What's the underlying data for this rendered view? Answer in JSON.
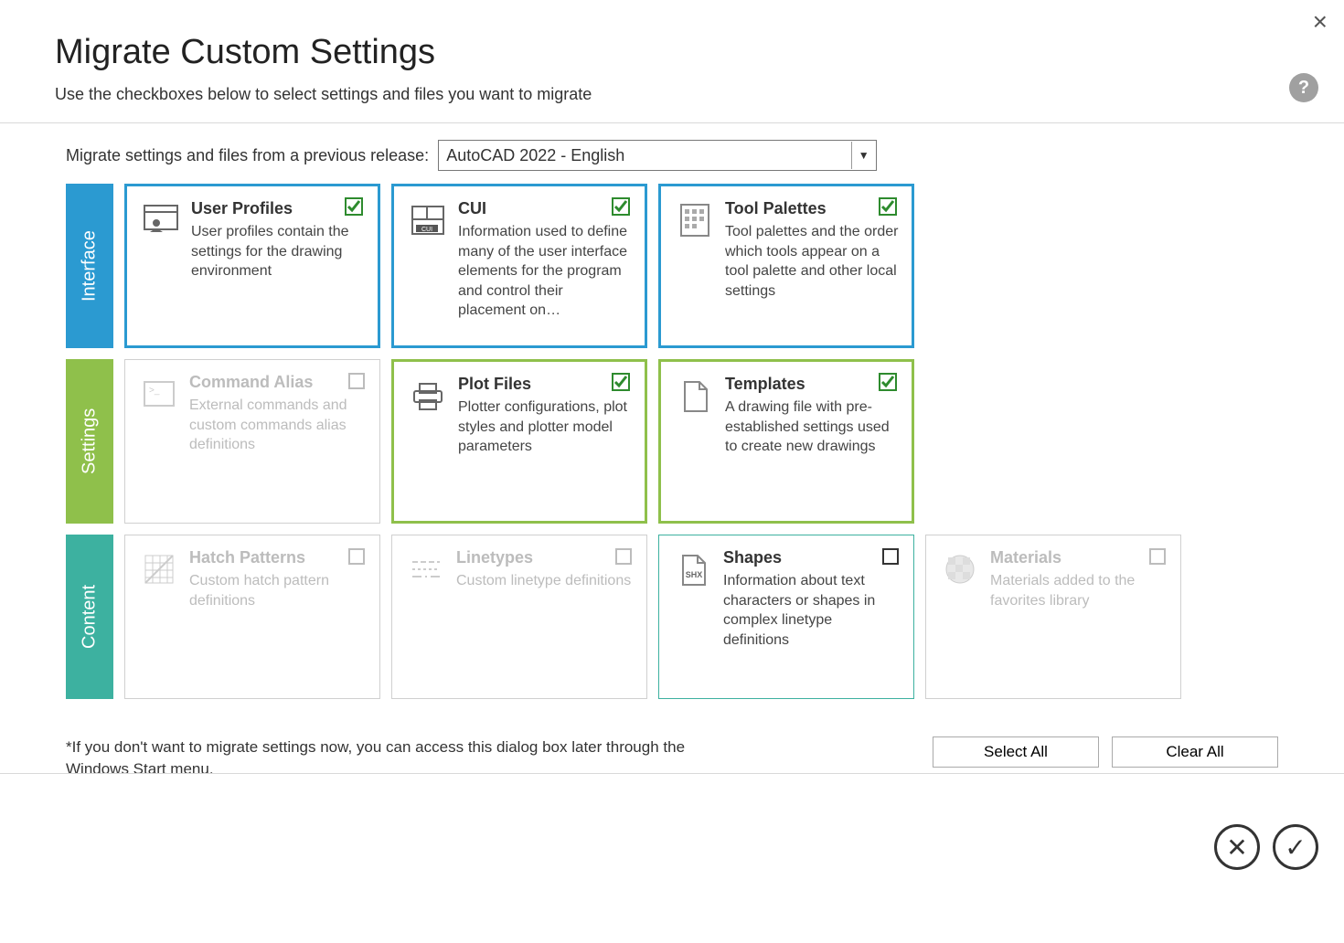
{
  "window": {
    "close_glyph": "×"
  },
  "header": {
    "title": "Migrate Custom Settings",
    "subtitle": "Use the checkboxes below to select settings and files you want to migrate",
    "help_glyph": "?"
  },
  "release": {
    "label": "Migrate settings and files from a previous release:",
    "selected": "AutoCAD 2022 - English"
  },
  "categories": {
    "interface": "Interface",
    "settings": "Settings",
    "content": "Content"
  },
  "tiles": {
    "user_profiles": {
      "title": "User Profiles",
      "desc": "User profiles contain the settings for the drawing environment",
      "checked": true,
      "enabled": true
    },
    "cui": {
      "title": "CUI",
      "desc": "Information used to define many of the user interface elements for the program and control their placement on…",
      "checked": true,
      "enabled": true
    },
    "tool_palettes": {
      "title": "Tool Palettes",
      "desc": "Tool palettes and the order which tools appear on a tool palette and other local settings",
      "checked": true,
      "enabled": true
    },
    "command_alias": {
      "title": "Command Alias",
      "desc": "External commands and custom commands alias definitions",
      "checked": false,
      "enabled": false
    },
    "plot_files": {
      "title": "Plot Files",
      "desc": "Plotter configurations, plot styles and plotter model parameters",
      "checked": true,
      "enabled": true
    },
    "templates": {
      "title": "Templates",
      "desc": "A drawing file with pre-established settings used to create new drawings",
      "checked": true,
      "enabled": true
    },
    "hatch_patterns": {
      "title": "Hatch Patterns",
      "desc": "Custom hatch pattern definitions",
      "checked": false,
      "enabled": false
    },
    "linetypes": {
      "title": "Linetypes",
      "desc": "Custom linetype definitions",
      "checked": false,
      "enabled": false
    },
    "shapes": {
      "title": "Shapes",
      "desc": "Information about text characters or shapes in complex linetype definitions",
      "checked": false,
      "enabled": true
    },
    "materials": {
      "title": "Materials",
      "desc": "Materials added to the favorites library",
      "checked": false,
      "enabled": false
    }
  },
  "footer": {
    "note": "*If you don't want to migrate settings now, you can access this dialog box later through the Windows Start menu.",
    "select_all": "Select All",
    "clear_all": "Clear All"
  },
  "actions": {
    "cancel_glyph": "✕",
    "ok_glyph": "✓"
  }
}
